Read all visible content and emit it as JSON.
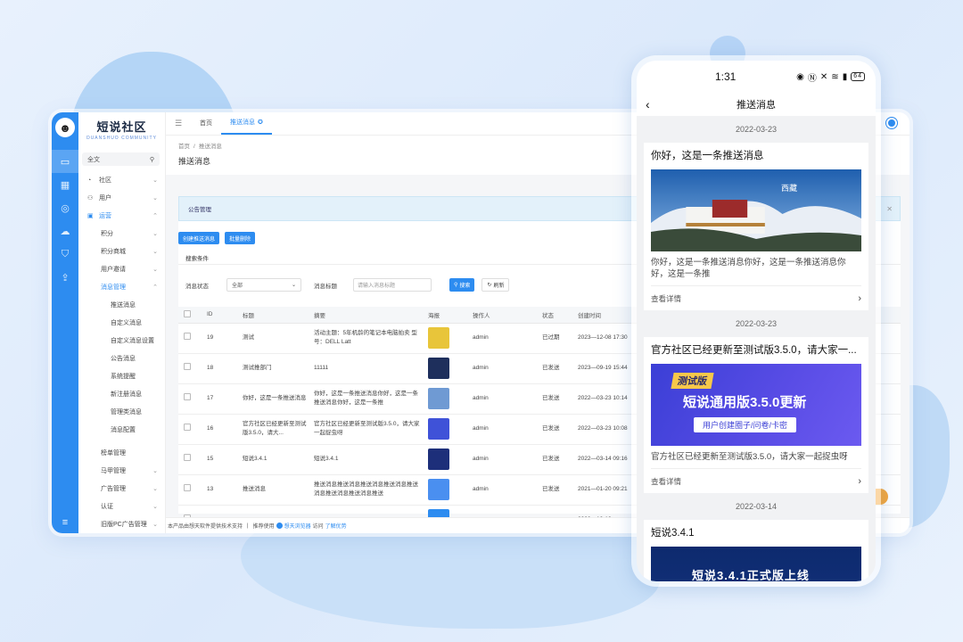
{
  "admin": {
    "logo": {
      "title": "短说社区",
      "subtitle": "DUANSHUO COMMUNITY"
    },
    "search": {
      "placeholder": "全文"
    },
    "menu": [
      {
        "label": "社区",
        "icon": "community-icon"
      },
      {
        "label": "用户",
        "icon": "user-icon"
      },
      {
        "label": "运营",
        "icon": "operate-icon"
      }
    ],
    "operate_sub": [
      "积分",
      "积分商城",
      "用户邀请",
      "消息管理"
    ],
    "message_sub": [
      "推送消息",
      "自定义消息",
      "自定义消息设置",
      "公告消息",
      "系统提醒",
      "新注册消息",
      "管理类消息",
      "消息配置"
    ],
    "bottom_menu": [
      "榜单管理",
      "马甲管理",
      "广告管理",
      "认证",
      "旧版PC广告管理"
    ],
    "tabs": {
      "home": "首页",
      "current": "推送消息"
    },
    "breadcrumb": {
      "home": "首页",
      "current": "推送消息"
    },
    "page_title": "推送消息",
    "notice": "公告管理",
    "buttons": {
      "create": "创建推送消息",
      "bulk_delete": "批量删除"
    },
    "search_label": "搜索条件",
    "filters": {
      "status_label": "消息状态",
      "status_value": "全部",
      "title_label": "消息标题",
      "title_placeholder": "请输入消息标题",
      "search_btn": "搜索",
      "refresh_btn": "刷新"
    },
    "columns": [
      "ID",
      "标题",
      "摘要",
      "海报",
      "操作人",
      "状态",
      "创建时间"
    ],
    "rows": [
      {
        "id": "19",
        "title": "测试",
        "summary": "活动主题：5年机龄的笔记本电脑拍卖 型号：DELL Latt",
        "poster": "#e8c53a",
        "operator": "admin",
        "status": "已过期",
        "time": "2023—12-08 17:30"
      },
      {
        "id": "18",
        "title": "测试推部门",
        "summary": "11111",
        "poster": "#1e2f5c",
        "operator": "admin",
        "status": "已发送",
        "time": "2023—09-19 15:44"
      },
      {
        "id": "17",
        "title": "你好，这是一条推送消息",
        "summary": "你好，这是一条推送消息你好，这是一条推送消息你好，这是一条推",
        "poster": "#6f9ad3",
        "operator": "admin",
        "status": "已发送",
        "time": "2022—03-23 10:14"
      },
      {
        "id": "16",
        "title": "官方社区已经更新至测试版3.5.0，请大...",
        "summary": "官方社区已经更新至测试版3.5.0，请大家一起捉虫呀",
        "poster": "#3f52d8",
        "operator": "admin",
        "status": "已发送",
        "time": "2022—03-23 10:08"
      },
      {
        "id": "15",
        "title": "短说3.4.1",
        "summary": "短说3.4.1",
        "poster": "#1d2f7a",
        "operator": "admin",
        "status": "已发送",
        "time": "2022—03-14 09:16"
      },
      {
        "id": "13",
        "title": "推送消息",
        "summary": "推送消息推送消息推送消息推送消息推送消息推送消息推送消息推送",
        "poster": "#4a8ff0",
        "operator": "admin",
        "status": "已发送",
        "time": "2021—01-20 09:21"
      },
      {
        "id": "",
        "title": "",
        "summary": "",
        "poster": "#2d8cf0",
        "operator": "",
        "status": "",
        "time": "2020—10-19"
      }
    ],
    "footer": {
      "text1": "本产品由想天软件提供技术支持",
      "sep": "|",
      "text2": "推荐使用",
      "browser": "想天浏览器",
      "text3": "访问",
      "more": "了解优势"
    }
  },
  "phone": {
    "time": "1:31",
    "battery": "64",
    "title": "推送消息",
    "cards": [
      {
        "date": "2022-03-23",
        "title": "你好，这是一条推送消息",
        "image_caption": "西藏",
        "desc": "你好，这是一条推送消息你好，这是一条推送消息你好，这是一条推",
        "more": "查看详情"
      },
      {
        "date": "2022-03-23",
        "title": "官方社区已经更新至测试版3.5.0，请大家一...",
        "banner_tag": "测试版",
        "banner_title": "短说通用版3.5.0更新",
        "banner_sub": "用户创建圈子/问卷/卡密",
        "desc": "官方社区已经更新至测试版3.5.0，请大家一起捉虫呀",
        "more": "查看详情"
      },
      {
        "date": "2022-03-14",
        "title": "短说3.4.1",
        "banner_title": "短说3.4.1正式版上线"
      }
    ]
  },
  "colors": {
    "accent": "#2d8cf0",
    "rail": "#2d8cf0"
  }
}
